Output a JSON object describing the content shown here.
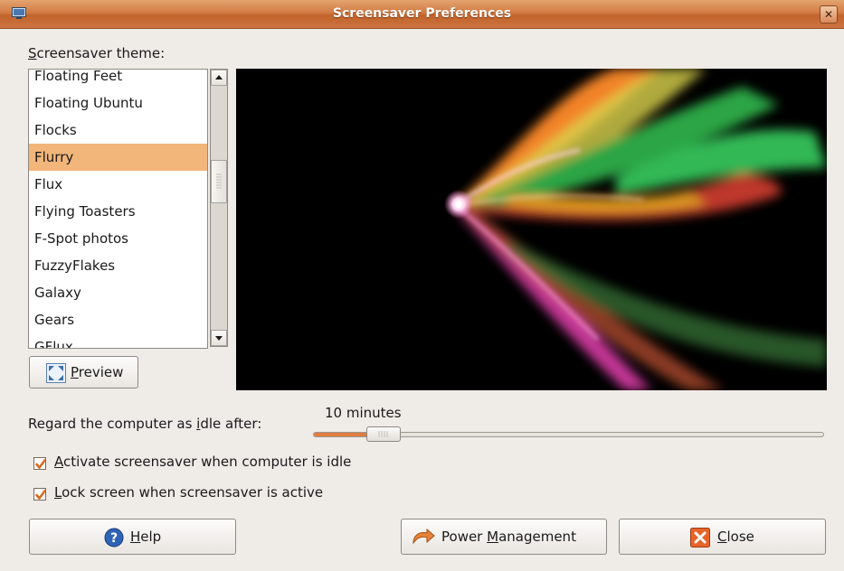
{
  "window": {
    "title": "Screensaver Preferences"
  },
  "theme_label": {
    "prefix": "",
    "mnemonic": "S",
    "rest": "creensaver theme:"
  },
  "themes": [
    {
      "label": "Floating Feet",
      "selected": false
    },
    {
      "label": "Floating Ubuntu",
      "selected": false
    },
    {
      "label": "Flocks",
      "selected": false
    },
    {
      "label": "Flurry",
      "selected": true
    },
    {
      "label": "Flux",
      "selected": false
    },
    {
      "label": "Flying Toasters",
      "selected": false
    },
    {
      "label": "F-Spot photos",
      "selected": false
    },
    {
      "label": "FuzzyFlakes",
      "selected": false
    },
    {
      "label": "Galaxy",
      "selected": false
    },
    {
      "label": "Gears",
      "selected": false
    },
    {
      "label": "GFlux",
      "selected": false
    }
  ],
  "preview_button": {
    "mnemonic": "P",
    "rest": "review"
  },
  "idle": {
    "label_prefix": "Regard the computer as ",
    "label_mnemonic": "i",
    "label_rest": "dle after:",
    "value_text": "10 minutes",
    "slider_fraction": 0.1
  },
  "checkboxes": {
    "activate": {
      "mnemonic": "A",
      "rest": "ctivate screensaver when computer is idle",
      "checked": true
    },
    "lock": {
      "mnemonic": "L",
      "rest": "ock screen when screensaver is active",
      "checked": true
    }
  },
  "buttons": {
    "help": {
      "mnemonic": "H",
      "rest": "elp"
    },
    "power": {
      "prefix": "Power ",
      "mnemonic": "M",
      "rest": "anagement"
    },
    "close": {
      "mnemonic": "C",
      "rest": "lose"
    }
  },
  "colors": {
    "selection": "#f2b57a",
    "accent": "#e07d41",
    "check": "#d86a1f"
  },
  "icons": {
    "window": "monitor-icon",
    "close": "close-icon",
    "preview": "fullscreen-icon",
    "help": "help-icon",
    "power": "power-management-icon",
    "close_button": "close-x-icon"
  }
}
